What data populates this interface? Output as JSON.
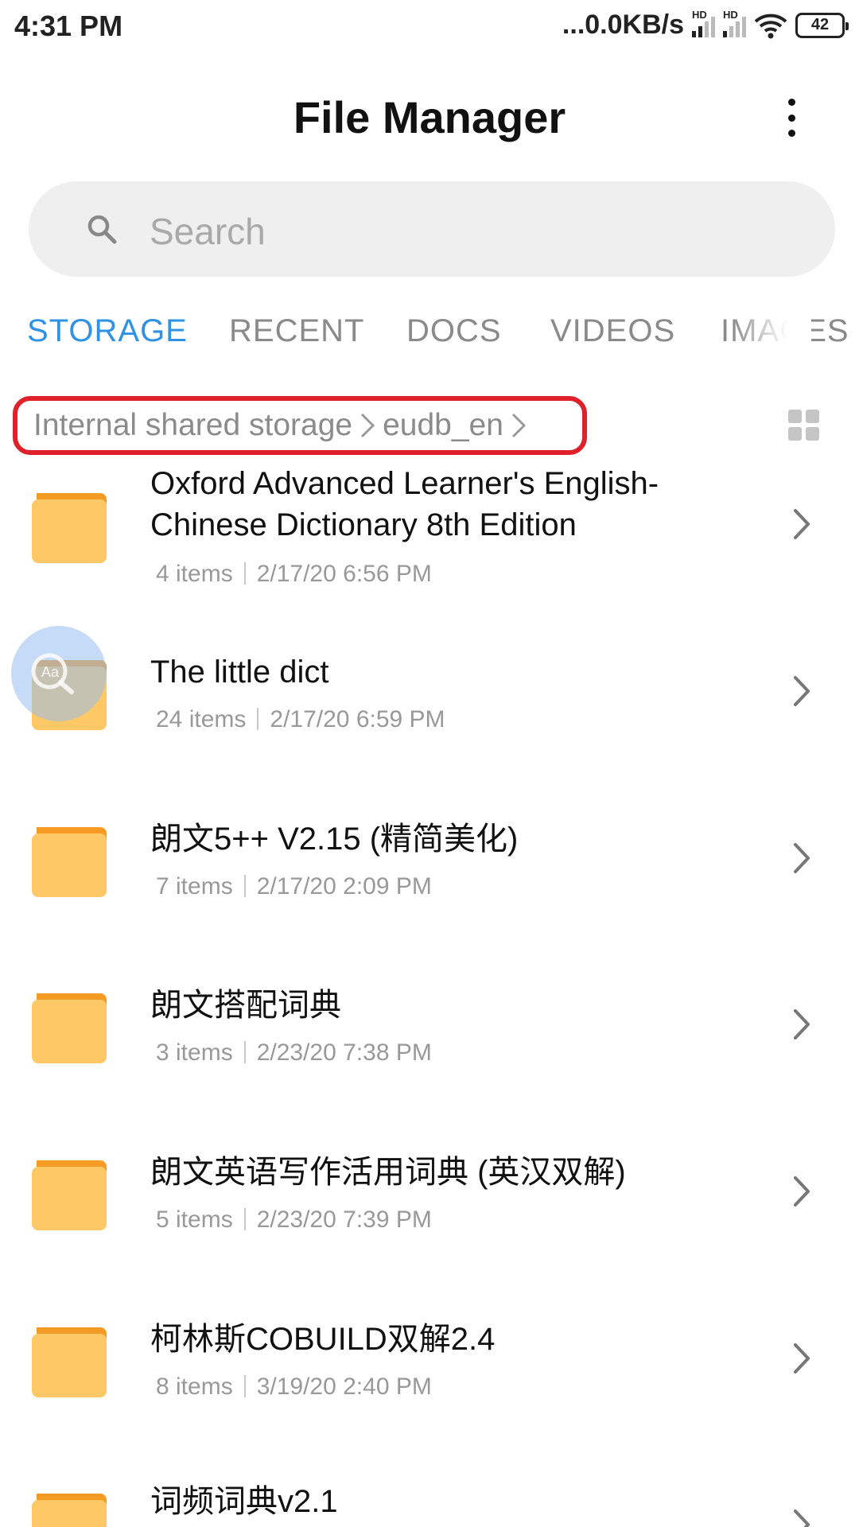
{
  "status_bar": {
    "time": "4:31 PM",
    "network_speed": "...0.0KB/s",
    "signal_1_label": "HD",
    "signal_2_label": "HD",
    "battery": "42"
  },
  "header": {
    "title": "File Manager"
  },
  "search": {
    "placeholder": "Search"
  },
  "tabs": [
    {
      "label": "STORAGE",
      "active": true
    },
    {
      "label": "RECENT",
      "active": false
    },
    {
      "label": "DOCS",
      "active": false
    },
    {
      "label": "VIDEOS",
      "active": false
    },
    {
      "label": "IMAGES",
      "active": false
    }
  ],
  "breadcrumb": {
    "items": [
      "Internal shared storage",
      "eudb_en"
    ]
  },
  "folders": [
    {
      "name": "Oxford Advanced Learner's English-Chinese Dictionary 8th Edition",
      "items": "4 items",
      "date": "2/17/20 6:56 PM"
    },
    {
      "name": "The little dict",
      "items": "24 items",
      "date": "2/17/20 6:59 PM"
    },
    {
      "name": "朗文5++ V2.15 (精简美化)",
      "items": "7 items",
      "date": "2/17/20 2:09 PM"
    },
    {
      "name": "朗文搭配词典",
      "items": "3 items",
      "date": "2/23/20 7:38 PM"
    },
    {
      "name": "朗文英语写作活用词典 (英汉双解)",
      "items": "5 items",
      "date": "2/23/20 7:39 PM"
    },
    {
      "name": "柯林斯COBUILD双解2.4",
      "items": "8 items",
      "date": "3/19/20 2:40 PM"
    },
    {
      "name": "词频词典v2.1",
      "items": "",
      "date": ""
    }
  ],
  "colors": {
    "accent": "#2e92e6",
    "folder_body": "#fec866",
    "folder_tab": "#f59b23",
    "highlight_border": "#e0202a"
  },
  "icons": {
    "search": "search-icon",
    "more": "more-vertical-icon",
    "grid": "grid-view-icon",
    "folder": "folder-icon",
    "chevron": "chevron-right-icon"
  }
}
